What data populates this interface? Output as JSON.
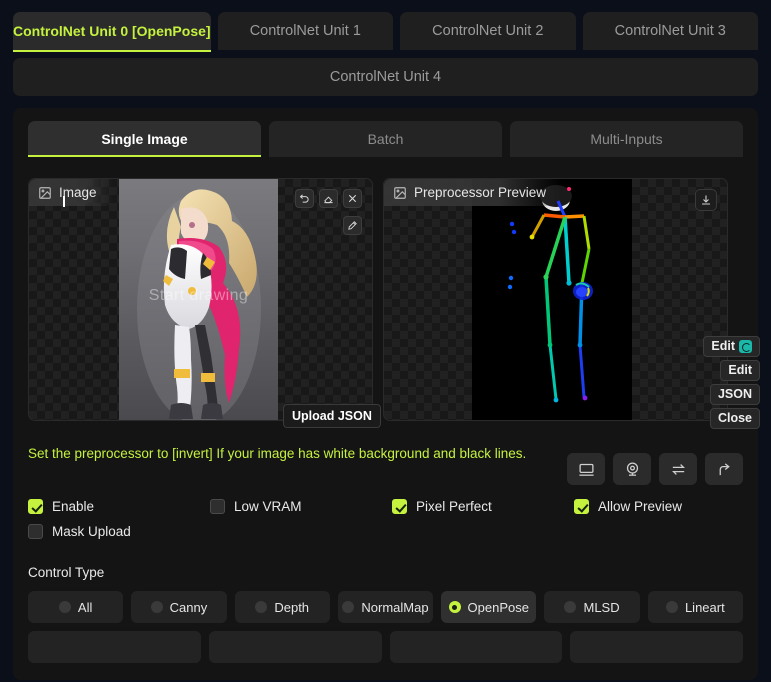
{
  "unit_tabs": [
    {
      "label": "ControlNet Unit 0 [OpenPose]",
      "active": true
    },
    {
      "label": "ControlNet Unit 1",
      "active": false
    },
    {
      "label": "ControlNet Unit 2",
      "active": false
    },
    {
      "label": "ControlNet Unit 3",
      "active": false
    },
    {
      "label": "ControlNet Unit 4",
      "active": false
    }
  ],
  "source_tabs": [
    {
      "label": "Single Image",
      "active": true
    },
    {
      "label": "Batch",
      "active": false
    },
    {
      "label": "Multi-Inputs",
      "active": false
    }
  ],
  "image_panel": {
    "label": "Image",
    "watermark": "Start drawing",
    "tools": [
      {
        "name": "undo-icon"
      },
      {
        "name": "eraser-icon"
      },
      {
        "name": "close-icon"
      },
      {
        "name": "pen-icon"
      }
    ]
  },
  "preview_panel": {
    "label": "Preprocessor Preview",
    "download_icon": "download-icon"
  },
  "tooltip": {
    "upload_json": "Upload JSON"
  },
  "float_buttons": [
    {
      "label": "Edit",
      "icon": "openpose-editor-icon"
    },
    {
      "label": "Edit",
      "icon": ""
    },
    {
      "label": "JSON",
      "icon": ""
    },
    {
      "label": "Close",
      "icon": ""
    }
  ],
  "notice": {
    "text": "Set the preprocessor to [invert] If your image has white background and black lines.",
    "color": "#c4f23e"
  },
  "icon_buttons": [
    {
      "name": "screen-capture-icon"
    },
    {
      "name": "webcam-icon"
    },
    {
      "name": "swap-icon"
    },
    {
      "name": "send-to-icon"
    }
  ],
  "checkboxes": [
    {
      "label": "Enable",
      "checked": true
    },
    {
      "label": "Low VRAM",
      "checked": false
    },
    {
      "label": "Pixel Perfect",
      "checked": true
    },
    {
      "label": "Allow Preview",
      "checked": true
    },
    {
      "label": "Mask Upload",
      "checked": false
    }
  ],
  "control_type": {
    "title": "Control Type",
    "options": [
      {
        "label": "All",
        "selected": false
      },
      {
        "label": "Canny",
        "selected": false
      },
      {
        "label": "Depth",
        "selected": false
      },
      {
        "label": "NormalMap",
        "selected": false
      },
      {
        "label": "OpenPose",
        "selected": true
      },
      {
        "label": "MLSD",
        "selected": false
      },
      {
        "label": "Lineart",
        "selected": false
      }
    ]
  },
  "colors": {
    "accent": "#c4f23e",
    "panel": "#141414",
    "background": "#0b0f19",
    "button": "#232323"
  }
}
